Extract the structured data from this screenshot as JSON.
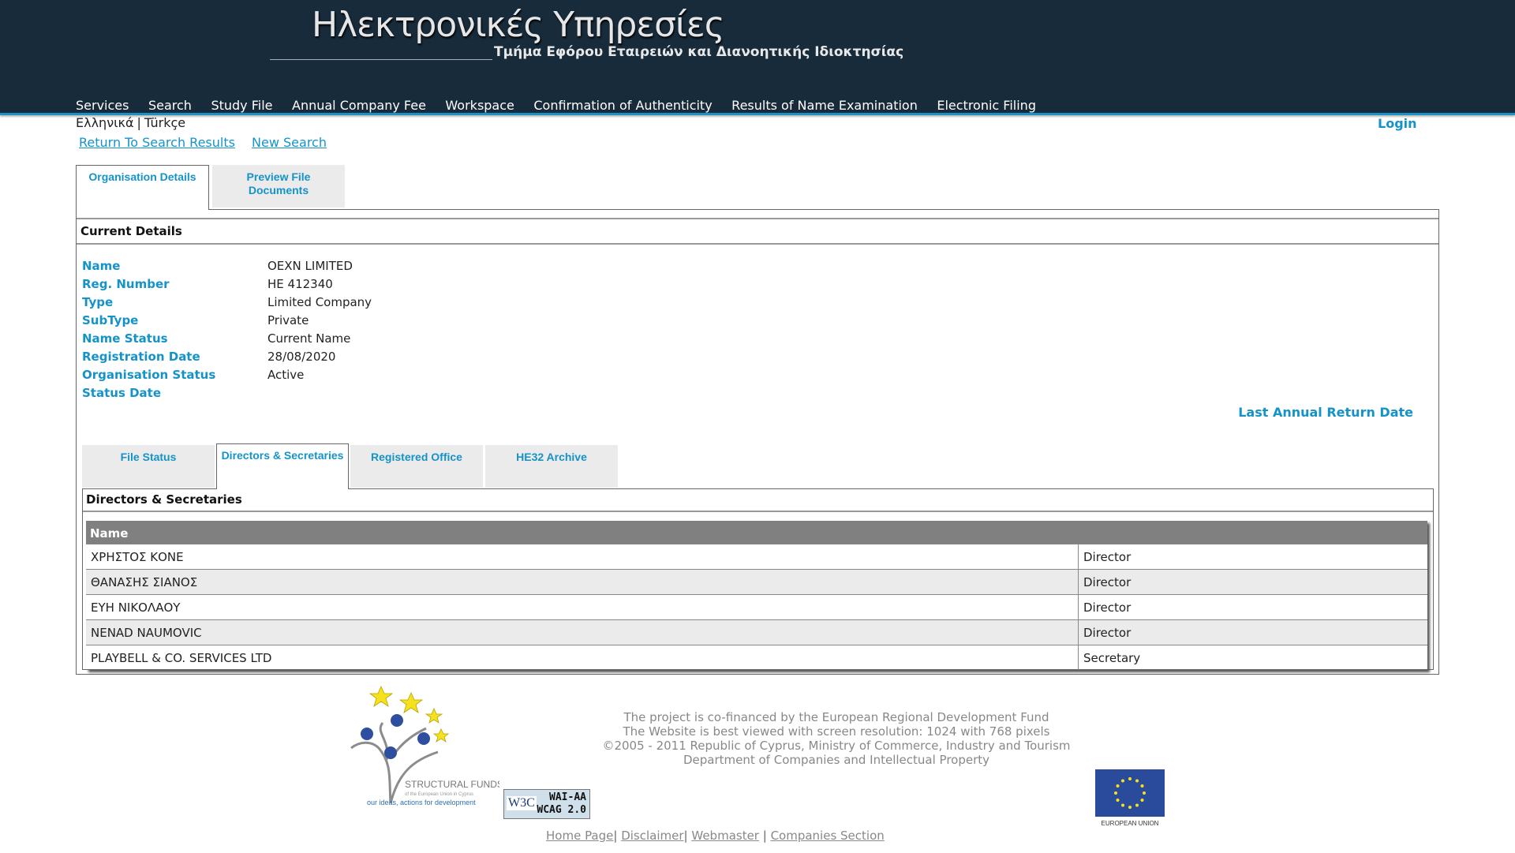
{
  "header": {
    "title": "Ηλεκτρονικές Υπηρεσίες",
    "subtitle": "Τμήμα Εφόρου Εταιρειών και Διανοητικής Ιδιοκτησίας",
    "nav": [
      "Services",
      "Search",
      "Study File",
      "Annual Company Fee",
      "Workspace",
      "Confirmation of Authenticity",
      "Results of Name Examination",
      "Electronic Filing"
    ],
    "languages": [
      "Ελληνικά",
      "Türkçe"
    ],
    "login": "Login"
  },
  "links": {
    "return": "Return To Search Results",
    "new_search": "New Search"
  },
  "outer_tabs": [
    {
      "label": "Organisation Details",
      "active": true
    },
    {
      "label": "Preview File Documents",
      "active": false
    }
  ],
  "current_details": {
    "heading": "Current Details",
    "rows": [
      {
        "label": "Name",
        "value": "OEXN LIMITED"
      },
      {
        "label": "Reg. Number",
        "value": "HE 412340"
      },
      {
        "label": "Type",
        "value": "Limited Company"
      },
      {
        "label": "SubType",
        "value": "Private"
      },
      {
        "label": "Name Status",
        "value": "Current Name"
      },
      {
        "label": "Registration Date",
        "value": "28/08/2020"
      },
      {
        "label": "Organisation Status",
        "value": "Active"
      },
      {
        "label": "Status Date",
        "value": ""
      }
    ],
    "last_annual_return_label": "Last Annual Return Date"
  },
  "inner_tabs": [
    {
      "label": "File Status",
      "active": false
    },
    {
      "label": "Directors & Secretaries",
      "active": true
    },
    {
      "label": "Registered Office",
      "active": false
    },
    {
      "label": "HE32 Archive",
      "active": false
    }
  ],
  "directors": {
    "heading": "Directors & Secretaries",
    "columns": [
      "Name",
      ""
    ],
    "rows": [
      {
        "name": "ΧΡΗΣΤΟΣ ΚΟΝΕ",
        "role": "Director"
      },
      {
        "name": "ΘΑΝΑΣΗΣ ΣΙΑΝΟΣ",
        "role": "Director"
      },
      {
        "name": "ΕΥΗ ΝΙΚΟΛΑΟΥ",
        "role": "Director"
      },
      {
        "name": "NENAD NAUMOVIC",
        "role": "Director"
      },
      {
        "name": "PLAYBELL & CO. SERVICES LTD",
        "role": "Secretary"
      }
    ]
  },
  "footer": {
    "sf_logo": {
      "title": "STRUCTURAL FUNDS",
      "sub": "of the European Union in Cyprus",
      "tagline": "our ideas, actions for development"
    },
    "w3c_badge": {
      "w3c": "W3C",
      "line1": "WAI-AA",
      "line2": "WCAG 2.0"
    },
    "lines": [
      "The project is co-financed by the European Regional Development Fund",
      "The Website is best viewed with screen resolution: 1024 with 768 pixels",
      "©2005 - 2011 Republic of Cyprus, Ministry of Commerce, Industry and Tourism",
      "Department of Companies and Intellectual Property"
    ],
    "eu_label": "EUROPEAN UNION",
    "links": [
      "Home Page",
      "Disclaimer",
      "Webmaster",
      "Companies Section"
    ]
  },
  "colors": {
    "header_bg": "#172b3b",
    "accent": "#1593c9",
    "table_header": "#808080",
    "row_alt": "#ebebeb"
  }
}
